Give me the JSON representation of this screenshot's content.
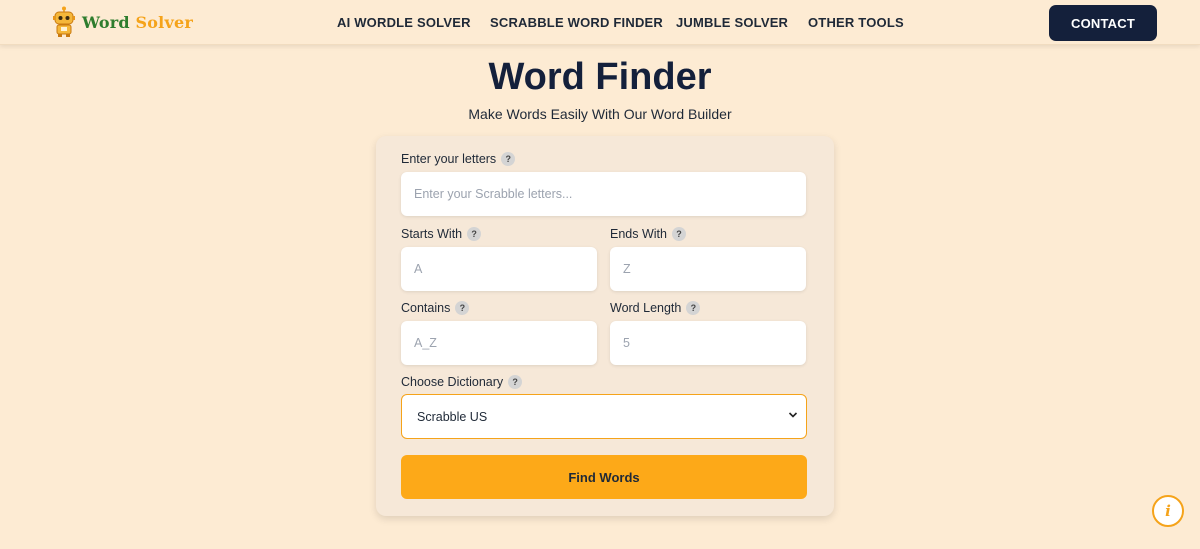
{
  "header": {
    "logo": {
      "word1": "Word",
      "word2": "Solver",
      "icon": "robot-logo-icon"
    },
    "nav": [
      {
        "label": "AI WORDLE SOLVER"
      },
      {
        "label": "SCRABBLE WORD FINDER"
      },
      {
        "label": "JUMBLE SOLVER"
      },
      {
        "label": "OTHER TOOLS"
      }
    ],
    "contact_label": "CONTACT"
  },
  "page": {
    "title": "Word Finder",
    "subtitle": "Make Words Easily With Our Word Builder"
  },
  "form": {
    "letters": {
      "label": "Enter your letters",
      "placeholder": "Enter your Scrabble letters...",
      "value": ""
    },
    "starts_with": {
      "label": "Starts With",
      "placeholder": "A",
      "value": ""
    },
    "ends_with": {
      "label": "Ends With",
      "placeholder": "Z",
      "value": ""
    },
    "contains": {
      "label": "Contains",
      "placeholder": "A_Z",
      "value": ""
    },
    "word_length": {
      "label": "Word Length",
      "placeholder": "5",
      "value": ""
    },
    "dictionary": {
      "label": "Choose Dictionary",
      "selected": "Scrabble US"
    },
    "help_glyph": "?",
    "submit_label": "Find Words"
  },
  "info_button": {
    "glyph": "i",
    "icon": "info-icon"
  },
  "colors": {
    "background": "#fdebd3",
    "navy": "#14203b",
    "accent": "#fda918",
    "logo_green": "#2e7d2e",
    "logo_orange": "#f5a31a"
  }
}
